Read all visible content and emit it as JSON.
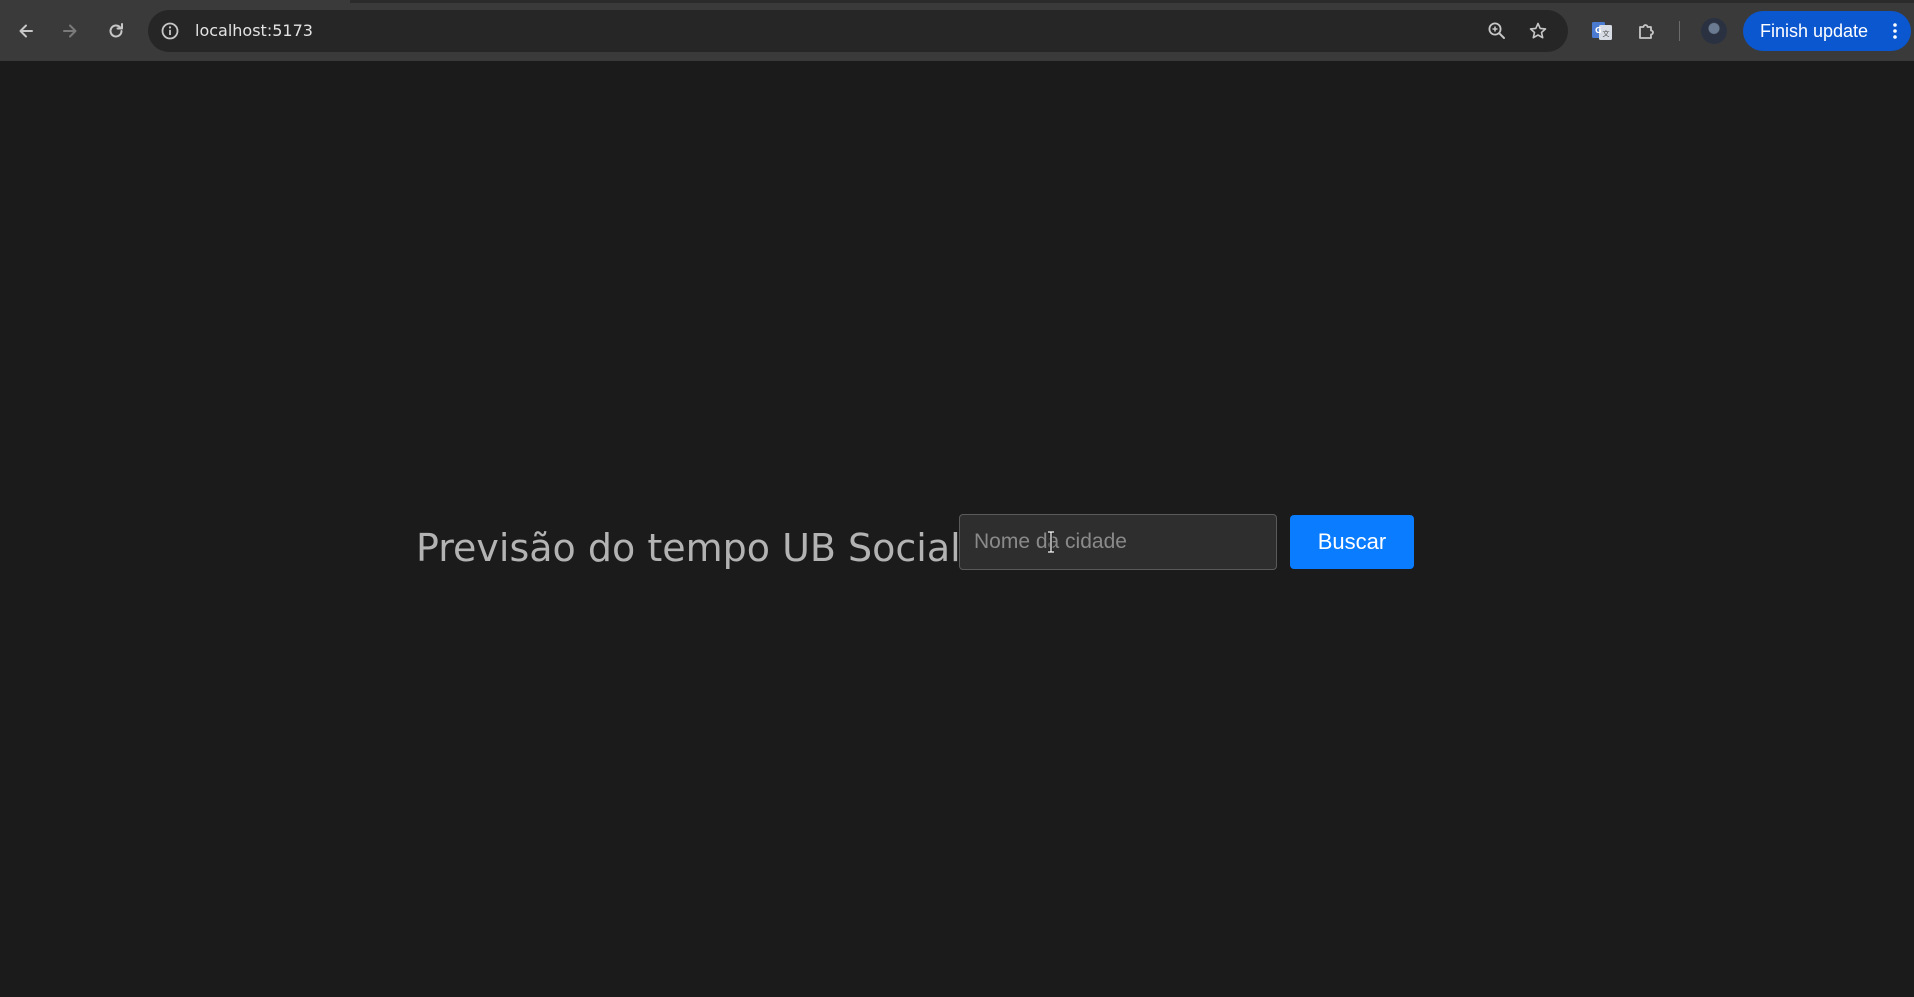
{
  "browser": {
    "url": "localhost:5173",
    "finish_update_label": "Finish update",
    "accent": "#0b57d0"
  },
  "page": {
    "heading": "Previsão do tempo UB Social:",
    "city_input": {
      "placeholder": "Nome da cidade",
      "value": ""
    },
    "search_button_label": "Buscar",
    "button_color": "#0a7cff",
    "background": "#1b1b1b"
  }
}
